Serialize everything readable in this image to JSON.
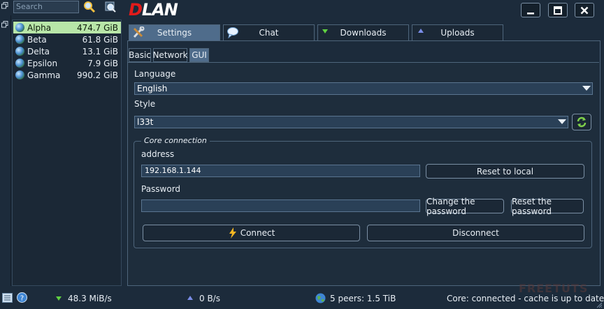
{
  "search": {
    "placeholder": "Search",
    "search_icon": "magnifier-icon",
    "search_own_icon": "search-own-files-icon"
  },
  "app": {
    "logo_text_d": "D",
    "logo_text_rest": "LAN"
  },
  "window_buttons": {
    "minimize": "minimize-icon",
    "maximize": "maximize-icon",
    "close": "close-icon"
  },
  "peers": [
    {
      "name": "Alpha",
      "size": "474.7 GiB",
      "selected": true
    },
    {
      "name": "Beta",
      "size": "61.8 GiB",
      "selected": false
    },
    {
      "name": "Delta",
      "size": "13.1 GiB",
      "selected": false
    },
    {
      "name": "Epsilon",
      "size": "7.9 GiB",
      "selected": false
    },
    {
      "name": "Gamma",
      "size": "990.2 GiB",
      "selected": false
    }
  ],
  "tabs": [
    {
      "label": "Settings",
      "icon": "tools-icon",
      "active": true
    },
    {
      "label": "Chat",
      "icon": "speech-bubble-icon",
      "active": false
    },
    {
      "label": "Downloads",
      "icon": "arrow-down-icon",
      "active": false
    },
    {
      "label": "Uploads",
      "icon": "arrow-up-icon",
      "active": false
    }
  ],
  "subtabs": [
    {
      "label": "Basic",
      "active": false
    },
    {
      "label": "Network",
      "active": false
    },
    {
      "label": "GUI",
      "active": true
    }
  ],
  "gui": {
    "language_label": "Language",
    "language_value": "English",
    "style_label": "Style",
    "style_value": "l33t",
    "reload_style_icon": "reload-icon"
  },
  "core": {
    "group_title": "Core connection",
    "address_label": "address",
    "address_value": "192.168.1.144",
    "reset_local_label": "Reset to local",
    "password_label": "Password",
    "password_value": "",
    "change_password_label": "Change the password",
    "reset_password_label": "Reset the password",
    "connect_label": "Connect",
    "disconnect_label": "Disconnect"
  },
  "status": {
    "download_rate": "48.3 MiB/s",
    "upload_rate": "0 B/s",
    "peers": "5 peers: 1.5 TiB",
    "core_status": "Core: connected - cache is up to date",
    "watermark": "FREETUTS"
  },
  "colors": {
    "background": "#1c2b3b",
    "selected_row": "#b8e6a8",
    "active_tab": "#4f6c8b",
    "logo_red": "#e21b1b",
    "download_green": "#5fd041",
    "upload_blue": "#7a8de8"
  }
}
